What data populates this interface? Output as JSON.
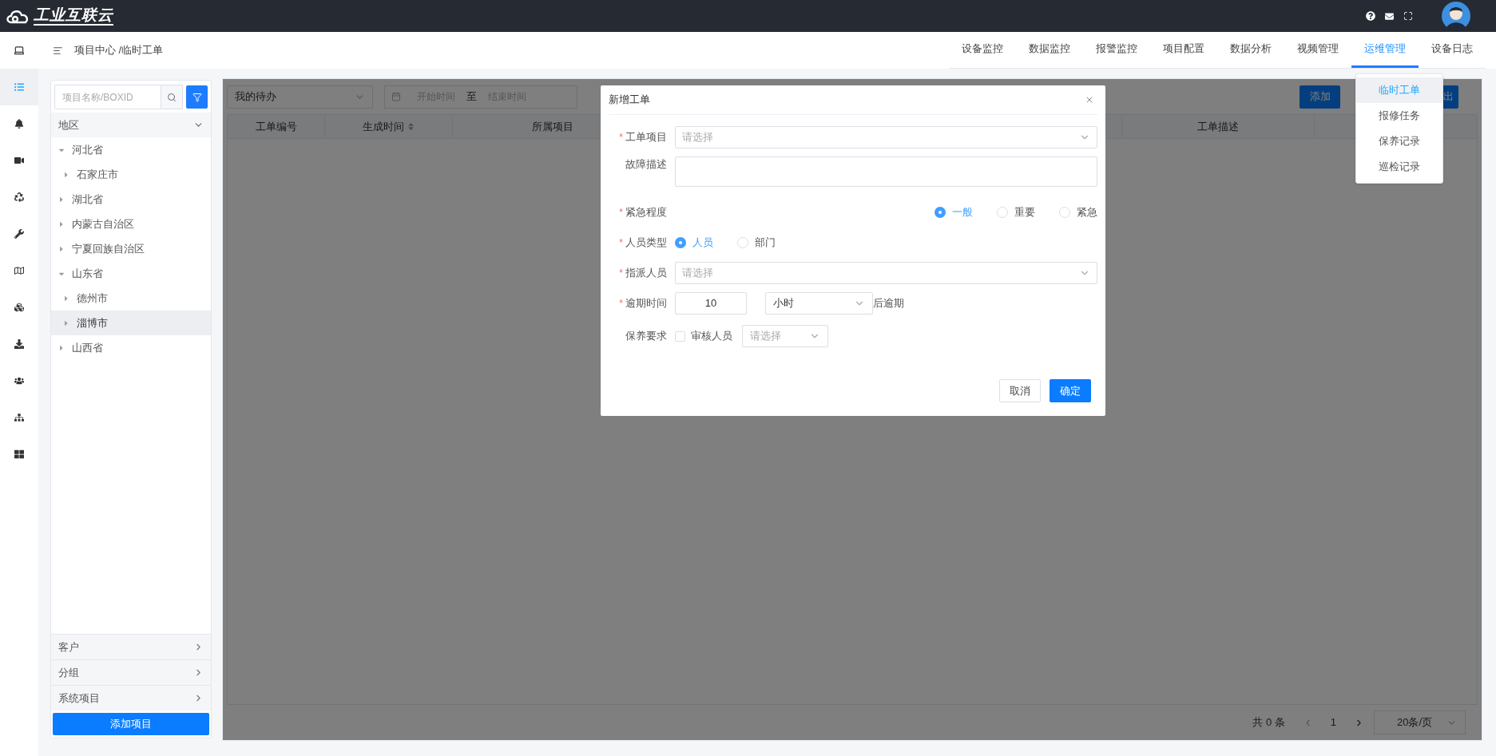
{
  "header": {
    "logo": "工业互联云"
  },
  "breadcrumb": "项目中心 /临时工单",
  "nav_tabs": [
    {
      "label": "设备监控",
      "selected": false
    },
    {
      "label": "数据监控",
      "selected": false
    },
    {
      "label": "报警监控",
      "selected": false
    },
    {
      "label": "项目配置",
      "selected": false
    },
    {
      "label": "数据分析",
      "selected": false
    },
    {
      "label": "视频管理",
      "selected": false
    },
    {
      "label": "运维管理",
      "selected": true
    },
    {
      "label": "设备日志",
      "selected": false
    }
  ],
  "nav_menu": [
    {
      "label": "临时工单",
      "selected": true
    },
    {
      "label": "报修任务",
      "selected": false
    },
    {
      "label": "保养记录",
      "selected": false
    },
    {
      "label": "巡检记录",
      "selected": false
    }
  ],
  "side_nav": [
    {
      "kind": "list",
      "selected": true
    },
    {
      "kind": "bell",
      "selected": false
    },
    {
      "kind": "video",
      "selected": false
    },
    {
      "kind": "recycle",
      "selected": false
    },
    {
      "kind": "wrench",
      "selected": false
    },
    {
      "kind": "map",
      "selected": false
    },
    {
      "kind": "cubes",
      "selected": false
    },
    {
      "kind": "download",
      "selected": false
    },
    {
      "kind": "users",
      "selected": false
    },
    {
      "kind": "sitemap",
      "selected": false
    },
    {
      "kind": "grid",
      "selected": false
    }
  ],
  "tree_panel": {
    "search_placeholder": "项目名称/BOXID",
    "section": {
      "label": "地区",
      "expanded": true
    },
    "tree": [
      {
        "label": "河北省",
        "expanded": true,
        "selected": false,
        "children": [
          {
            "label": "石家庄市",
            "expanded": false,
            "selected": false
          }
        ]
      },
      {
        "label": "湖北省",
        "expanded": false,
        "selected": false
      },
      {
        "label": "内蒙古自治区",
        "expanded": false,
        "selected": false
      },
      {
        "label": "宁夏回族自治区",
        "expanded": false,
        "selected": false
      },
      {
        "label": "山东省",
        "expanded": true,
        "selected": false,
        "children": [
          {
            "label": "德州市",
            "expanded": false,
            "selected": false
          },
          {
            "label": "淄博市",
            "expanded": false,
            "selected": true
          }
        ]
      },
      {
        "label": "山西省",
        "expanded": false,
        "selected": false
      }
    ],
    "footer_sections": [
      "客户",
      "分组",
      "系统项目"
    ],
    "add_button": "添加项目"
  },
  "toolbar": {
    "filter": "我的待办",
    "start_placeholder": "开始时间",
    "range_separator": "至",
    "end_placeholder": "结束时间",
    "buttons": [
      "添加",
      "出"
    ]
  },
  "table": {
    "columns": [
      {
        "label": "工单编号",
        "sortable": false
      },
      {
        "label": "生成时间",
        "sortable": true
      },
      {
        "label": "所属项目",
        "sortable": false
      },
      {
        "label": "工单描述",
        "sortable": false
      }
    ]
  },
  "pagination": {
    "total": "共 0 条",
    "page": "1",
    "page_size": "20条/页"
  },
  "modal": {
    "title": "新增工单",
    "fields": [
      {
        "kind": "select",
        "required_mark": "*",
        "label": "工单项目",
        "placeholder": "请选择"
      },
      {
        "kind": "textarea",
        "label": "故障描述"
      },
      {
        "kind": "radio_end",
        "required_mark": "*",
        "label": "紧急程度",
        "options": [
          {
            "label": "一般",
            "selected": true
          },
          {
            "label": "重要",
            "selected": false
          },
          {
            "label": "紧急",
            "selected": false
          }
        ]
      },
      {
        "kind": "radio",
        "required_mark": "*",
        "label": "人员类型",
        "options": [
          {
            "label": "人员",
            "selected": true
          },
          {
            "label": "部门",
            "selected": false
          }
        ]
      },
      {
        "kind": "select",
        "required_mark": "*",
        "label": "指派人员",
        "placeholder": "请选择"
      },
      {
        "kind": "deadline",
        "required_mark": "*",
        "label": "逾期时间",
        "value": "10",
        "unit": "小时",
        "suffix": "后逾期"
      },
      {
        "kind": "check_select",
        "label": "保养要求",
        "checkbox": {
          "label": "审核人员",
          "checked": false
        },
        "placeholder": "请选择"
      }
    ],
    "buttons": {
      "cancel": "取消",
      "confirm": "确定"
    }
  }
}
